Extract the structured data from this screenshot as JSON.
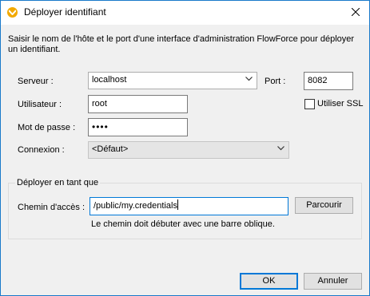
{
  "window": {
    "title": "Déployer identifiant",
    "intro": "Saisir le nom de l'hôte et le port d'une interface d'administration FlowForce pour déployer un identifiant."
  },
  "form": {
    "server_label": "Serveur :",
    "server_value": "localhost",
    "port_label": "Port :",
    "port_value": "8082",
    "user_label": "Utilisateur :",
    "user_value": "root",
    "ssl_label": "Utiliser SSL",
    "ssl_checked": false,
    "password_label": "Mot de passe :",
    "password_value": "••••",
    "connection_label": "Connexion :",
    "connection_value": "<Défaut>"
  },
  "deploy": {
    "group_title": "Déployer en tant que",
    "path_label": "Chemin d'accès :",
    "path_value": "/public/my.credentials",
    "browse_label": "Parcourir",
    "hint": "Le chemin doit débuter avec une barre oblique."
  },
  "buttons": {
    "ok_label": "OK",
    "cancel_label": "Annuler"
  },
  "icons": {
    "app": "mapforce-app-icon",
    "close": "close-icon",
    "dropdown": "chevron-down-icon"
  },
  "colors": {
    "window_border": "#1979ca",
    "app_icon": "#f2a900",
    "default_button_border": "#0078d7"
  }
}
